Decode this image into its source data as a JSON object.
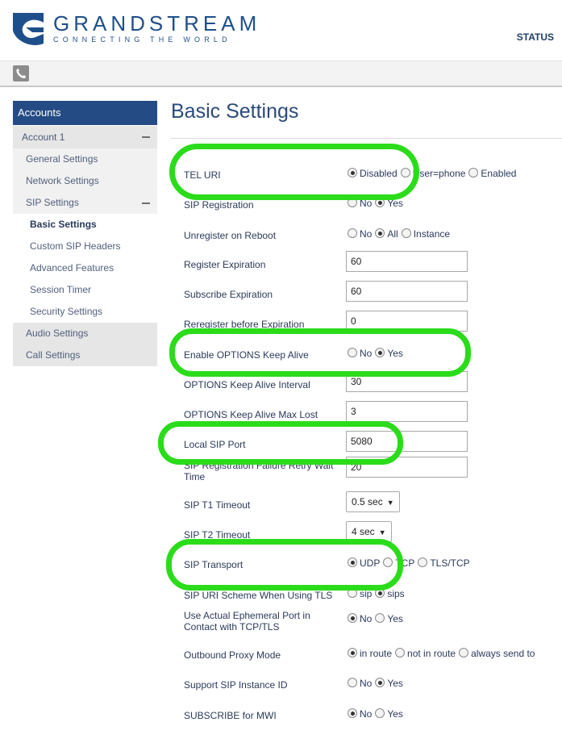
{
  "header": {
    "brand": "GRANDSTREAM",
    "tagline": "CONNECTING THE WORLD",
    "status_link": "STATUS"
  },
  "sidebar": {
    "heading": "Accounts",
    "account": "Account 1",
    "items_top": [
      "General Settings",
      "Network Settings",
      "SIP Settings"
    ],
    "sip_sub": [
      "Basic Settings",
      "Custom SIP Headers",
      "Advanced Features",
      "Session Timer",
      "Security Settings"
    ],
    "items_bottom": [
      "Audio Settings",
      "Call Settings"
    ],
    "active": "Basic Settings"
  },
  "main": {
    "title": "Basic Settings",
    "rows": [
      {
        "label": "TEL URI",
        "type": "radio",
        "options": [
          "Disabled",
          "User=phone",
          "Enabled"
        ],
        "selected": 0
      },
      {
        "label": "SIP Registration",
        "type": "radio",
        "options": [
          "No",
          "Yes"
        ],
        "selected": 1
      },
      {
        "label": "Unregister on Reboot",
        "type": "radio",
        "options": [
          "No",
          "All",
          "Instance"
        ],
        "selected": 1
      },
      {
        "label": "Register Expiration",
        "type": "text",
        "value": "60"
      },
      {
        "label": "Subscribe Expiration",
        "type": "text",
        "value": "60"
      },
      {
        "label": "Reregister before Expiration",
        "type": "text",
        "value": "0"
      },
      {
        "label": "Enable OPTIONS Keep Alive",
        "type": "radio",
        "options": [
          "No",
          "Yes"
        ],
        "selected": 1
      },
      {
        "label": "OPTIONS Keep Alive Interval",
        "type": "text",
        "value": "30"
      },
      {
        "label": "OPTIONS Keep Alive Max Lost",
        "type": "text",
        "value": "3"
      },
      {
        "label": "Local SIP Port",
        "type": "text",
        "value": "5080"
      },
      {
        "label": "SIP Registration Failure Retry Wait Time",
        "type": "text",
        "value": "20"
      },
      {
        "label": "SIP T1 Timeout",
        "type": "select",
        "value": "0.5 sec"
      },
      {
        "label": "SIP T2 Timeout",
        "type": "select",
        "value": "4 sec"
      },
      {
        "label": "SIP Transport",
        "type": "radio",
        "options": [
          "UDP",
          "TCP",
          "TLS/TCP"
        ],
        "selected": 0
      },
      {
        "label": "SIP URI Scheme When Using TLS",
        "type": "radio",
        "options": [
          "sip",
          "sips"
        ],
        "selected": 1
      },
      {
        "label": "Use Actual Ephemeral Port in Contact with TCP/TLS",
        "type": "radio",
        "options": [
          "No",
          "Yes"
        ],
        "selected": 0
      },
      {
        "label": "Outbound Proxy Mode",
        "type": "radio",
        "options": [
          "in route",
          "not in route",
          "always send to"
        ],
        "selected": 0
      },
      {
        "label": "Support SIP Instance ID",
        "type": "radio",
        "options": [
          "No",
          "Yes"
        ],
        "selected": 1
      },
      {
        "label": "SUBSCRIBE for MWI",
        "type": "radio",
        "options": [
          "No",
          "Yes"
        ],
        "selected": 0
      }
    ]
  },
  "highlight_color": "#2bdc1a"
}
